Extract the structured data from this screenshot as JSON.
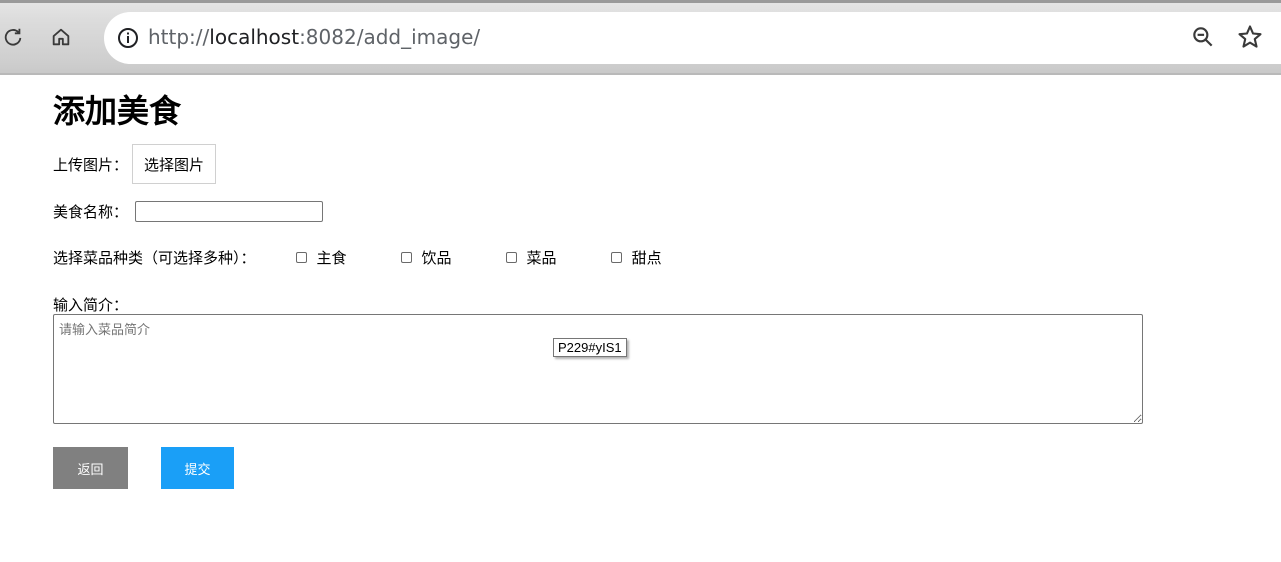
{
  "browser": {
    "url_prefix": "http://",
    "url_host": "localhost",
    "url_rest": ":8082/add_image/",
    "icons": [
      "reload-icon",
      "home-icon",
      "info-icon",
      "zoom-icon",
      "bookmark-star-icon"
    ]
  },
  "page": {
    "title": "添加美食",
    "upload": {
      "label": "上传图片：",
      "button": "选择图片"
    },
    "name": {
      "label": "美食名称：",
      "value": ""
    },
    "category": {
      "label": "选择菜品种类（可选择多种）：",
      "options": [
        "主食",
        "饮品",
        "菜品",
        "甜点"
      ]
    },
    "intro": {
      "label": "输入简介：",
      "placeholder": "请输入菜品简介",
      "value": ""
    },
    "tooltip": "P229#yIS1",
    "buttons": {
      "back": "返回",
      "submit": "提交"
    },
    "colors": {
      "back": "#808080",
      "submit": "#1a9ff7"
    }
  }
}
